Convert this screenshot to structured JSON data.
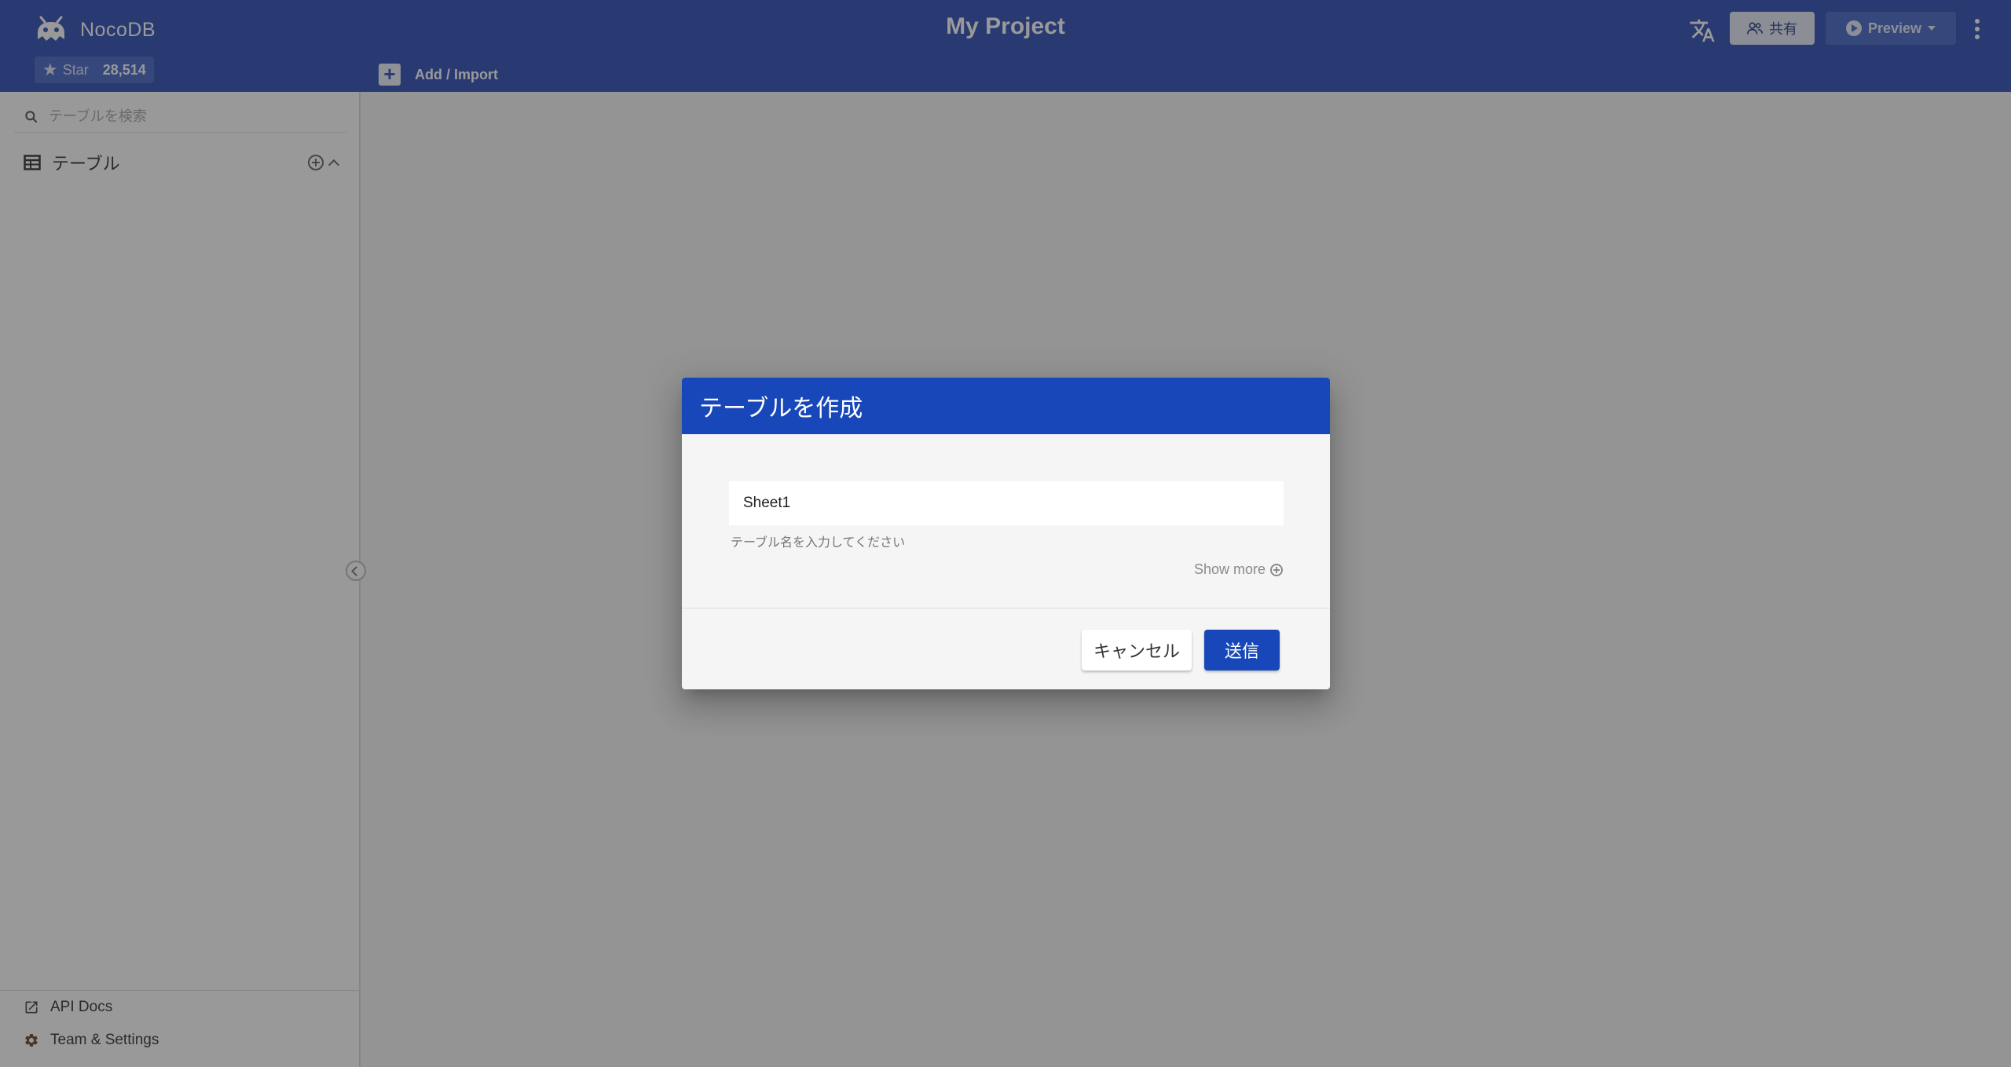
{
  "app": {
    "brand_name": "NocoDB",
    "star_label": "Star",
    "star_count": "28,514",
    "project_title": "My Project",
    "add_import_label": "Add / Import",
    "share_label": "共有",
    "preview_label": "Preview"
  },
  "sidebar": {
    "search_placeholder": "テーブルを検索",
    "tables_label": "テーブル",
    "footer": {
      "api_docs": "API Docs",
      "team_settings": "Team & Settings"
    }
  },
  "dialog": {
    "title": "テーブルを作成",
    "table_name_value": "Sheet1",
    "table_name_hint": "テーブル名を入力してください",
    "show_more": "Show more",
    "cancel_label": "キャンセル",
    "submit_label": "送信"
  },
  "colors": {
    "header": "#3050b8",
    "dialog_header": "#1747b8",
    "primary_button": "#1747b8"
  }
}
